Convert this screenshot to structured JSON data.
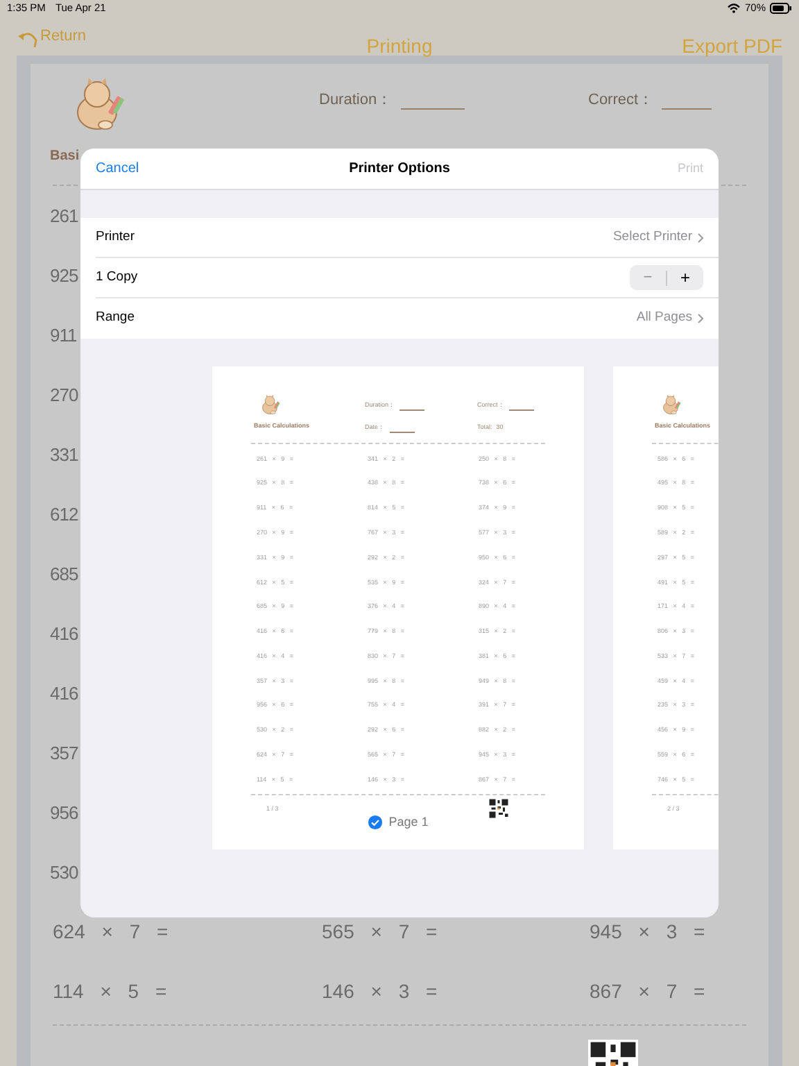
{
  "status_bar": {
    "time": "1:35 PM",
    "date": "Tue Apr 21",
    "battery": "70%"
  },
  "nav": {
    "back": "Return",
    "title": "Printing",
    "action": "Export PDF"
  },
  "worksheet": {
    "duration_label": "Duration：",
    "correct_label": "Correct：",
    "title": "Basi",
    "cut_rows": [
      "261",
      "925",
      "911",
      "270",
      "331",
      "612",
      "685",
      "416",
      "416",
      "357",
      "956",
      "530"
    ],
    "rows": [
      [
        "624 × 7 =",
        "565 × 7 =",
        "945 × 3 ="
      ],
      [
        "114 × 5 =",
        "146 × 3 =",
        "867 × 7 ="
      ]
    ]
  },
  "dialog": {
    "cancel": "Cancel",
    "title": "Printer Options",
    "print": {
      "label": "Print",
      "disabled": true
    },
    "options": [
      {
        "kind": "link",
        "label": "Printer",
        "value": "Select Printer"
      },
      {
        "kind": "stepper",
        "label": "1 Copy",
        "minus": "−",
        "plus": "+"
      },
      {
        "kind": "link",
        "label": "Range",
        "value": "All Pages"
      }
    ],
    "pages": [
      {
        "title": "Basic Calculations",
        "duration_label": "Duration：",
        "correct_label": "Correct：",
        "date_label": "Date：",
        "total_label": "Total:",
        "total": "30",
        "columns": [
          [
            "261 × 9 =",
            "925 × 8 =",
            "911 × 6 =",
            "270 × 9 =",
            "331 × 9 =",
            "612 × 5 =",
            "685 × 9 =",
            "416 × 6 =",
            "416 × 4 =",
            "357 × 3 =",
            "956 × 6 =",
            "530 × 2 =",
            "624 × 7 =",
            "114 × 5 ="
          ],
          [
            "341 × 2 =",
            "438 × 8 =",
            "814 × 5 =",
            "767 × 3 =",
            "292 × 2 =",
            "535 × 9 =",
            "376 × 4 =",
            "779 × 8 =",
            "830 × 7 =",
            "995 × 8 =",
            "755 × 4 =",
            "292 × 6 =",
            "565 × 7 =",
            "146 × 3 ="
          ],
          [
            "250 × 8 =",
            "738 × 6 =",
            "374 × 9 =",
            "577 × 3 =",
            "950 × 6 =",
            "324 × 7 =",
            "890 × 4 =",
            "315 × 2 =",
            "381 × 6 =",
            "949 × 8 =",
            "391 × 7 =",
            "882 × 2 =",
            "945 × 3 =",
            "867 × 7 ="
          ]
        ],
        "page_number": "1 / 3",
        "label": "Page 1",
        "selected": true
      },
      {
        "title": "Basic Calculations",
        "columns": [
          [
            "586 × 6 =",
            "495 × 8 =",
            "908 × 5 =",
            "589 × 2 =",
            "297 × 5 =",
            "491 × 5 =",
            "171 × 4 =",
            "806 × 3 =",
            "533 × 7 =",
            "459 × 4 =",
            "235 × 3 =",
            "456 × 9 =",
            "559 × 6 =",
            "746 × 5 ="
          ]
        ],
        "page_number": "2 / 3"
      }
    ]
  }
}
